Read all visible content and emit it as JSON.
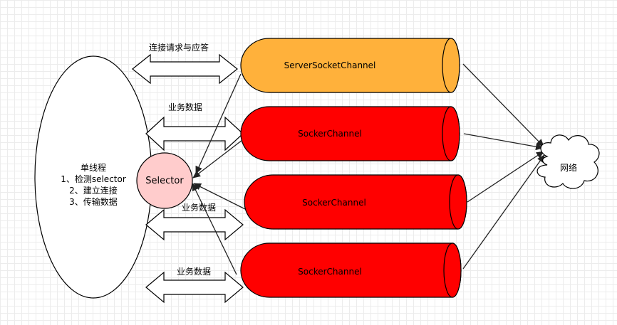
{
  "thread": {
    "title": "单线程",
    "line1": "1、检测selector",
    "line2": "2、建立连接",
    "line3": "3、传输数据"
  },
  "selector": {
    "label": "Selector",
    "color": "#ffcccc"
  },
  "network": {
    "label": "网络"
  },
  "channels": {
    "server": {
      "label": "ServerSocketChannel",
      "color": "#ffb13b"
    },
    "c1": {
      "label": "SockerChannel",
      "color": "#ff0000"
    },
    "c2": {
      "label": "SockerChannel",
      "color": "#ff0000"
    },
    "c3": {
      "label": "SockerChannel",
      "color": "#ff0000"
    }
  },
  "arrows": {
    "connect": "连接请求与应答",
    "data1": "业务数据",
    "data2": "业务数据",
    "data3": "业务数据"
  }
}
